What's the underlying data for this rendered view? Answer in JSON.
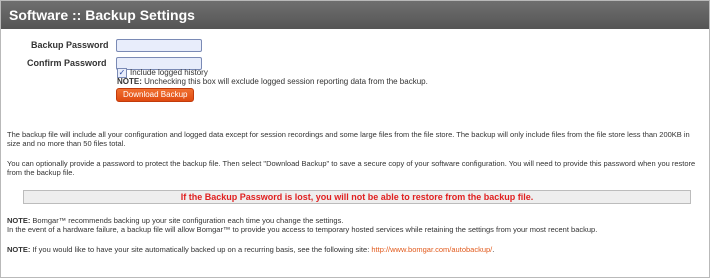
{
  "header": {
    "title": "Software :: Backup Settings"
  },
  "form": {
    "backup_password_label": "Backup Password",
    "confirm_password_label": "Confirm Password",
    "backup_password_value": "",
    "confirm_password_value": "",
    "include_history_label": "Include logged history",
    "include_history_checked": true,
    "note_label": "NOTE:",
    "note_text": " Unchecking this box will exclude logged session reporting data from the backup.",
    "download_button": "Download Backup"
  },
  "info": {
    "para1": "The backup file will include all your configuration and logged data except for session recordings and some large files from the file store. The backup will only include files from the file store less than 200KB in size and no more than 50 files total.",
    "para2": "You can optionally provide a password to protect the backup file. Then select \"Download Backup\" to save a secure copy of your software configuration. You will need to provide this password when you restore from the backup file.",
    "warning": "If the Backup Password is lost, you will not be able to restore from the backup file.",
    "note1_label": "NOTE:",
    "note1_line1": " Bomgar™ recommends backing up your site configuration each time you change the settings.",
    "note1_line2": "In the event of a hardware failure, a backup file will allow Bomgar™ to provide you access to temporary hosted services while retaining the settings from your most recent backup.",
    "note2_label": "NOTE:",
    "note2_text": " If you would like to have your site automatically backed up on a recurring basis, see the following site: ",
    "note2_link": "http://www.bomgar.com/autobackup/",
    "note2_end": "."
  },
  "colors": {
    "header_bg": "#5f5f5f",
    "button_bg": "#e85a1a",
    "warning_text": "#e02020",
    "link": "#e25a1c"
  }
}
